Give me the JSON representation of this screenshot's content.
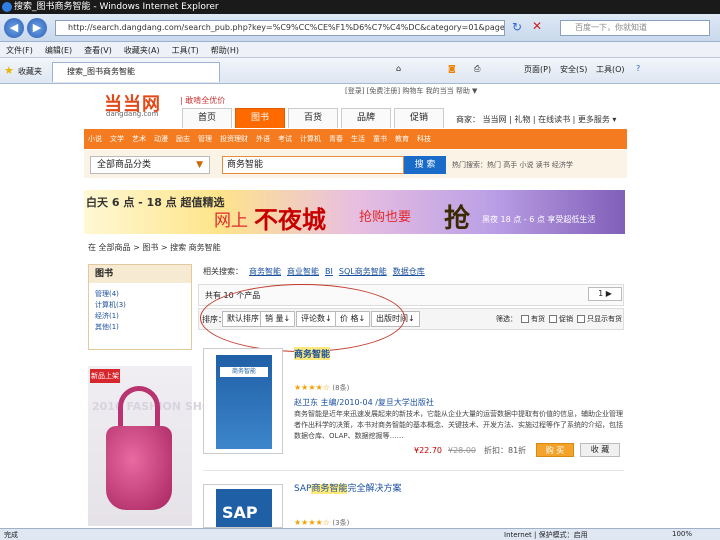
{
  "window": {
    "title": "搜索_图书商务智能 - Windows Internet Explorer"
  },
  "toolbar": {
    "back": "◀",
    "forward": "▶",
    "url": "http://search.dangdang.com/search_pub.php?key=%C9%CC%CE%F1%D6%C7%C4%DC&category=01&page=1&in-stock=1",
    "search_placeholder": "百度一下，你就知道"
  },
  "menu": [
    "文件(F)",
    "编辑(E)",
    "查看(V)",
    "收藏夹(A)",
    "工具(T)",
    "帮助(H)"
  ],
  "favbar": {
    "favorites": "收藏夹",
    "tab": "搜索_图书商务智能",
    "page": "页面(P)",
    "safety": "安全(S)",
    "tools": "工具(O)"
  },
  "site": {
    "logo": "当当网",
    "logo_sub": "dangdang.com",
    "slogan": "| 敢啃全优价",
    "top_links": "[登录] [免费注册] 购物车 我的当当 帮助 ▼",
    "tabs": [
      "首页",
      "图书",
      "百货",
      "品牌",
      "促销"
    ],
    "right_links": "商家： 当当网 | 礼物 | 在线读书 | 更多服务 ▾",
    "orange_nav": [
      "小说",
      "文学",
      "艺术",
      "动漫",
      "励志",
      "管理",
      "投资理财",
      "外语",
      "考试",
      "计算机",
      "青春",
      "生活",
      "童书",
      "教育",
      "科技"
    ],
    "category_select": "全部商品分类",
    "search_query": "商务智能",
    "search_button": "搜 索",
    "hot_words": "热门搜索：热门 高手 小说 读书 经济学"
  },
  "banner": {
    "line1": "白天 6 点 - 18 点 超值精选",
    "line2": "网上",
    "line3": "不夜城",
    "line4": "抢购也要",
    "line5": "抢",
    "line6": "黑夜 18 点 - 6 点 享受超低生活"
  },
  "breadcrumb": "在 全部商品 > 图书 > 搜索 商务智能",
  "left_panel": {
    "header": "图书",
    "items": [
      "管理(4)",
      "计算机(3)",
      "经济(1)",
      "其他(1)"
    ]
  },
  "ad": {
    "tag": "新品上架",
    "watermark": "2010 FASHION SHOW"
  },
  "subnav": [
    "相关搜索：",
    "商务智能",
    "商业智能",
    "BI",
    "SQL商务智能",
    "数据仓库"
  ],
  "results": {
    "count_text": "共有 10 个产品",
    "pager": "1 ▶",
    "sort_label": "排序：",
    "sort_options": [
      "默认排序",
      "销 量↓",
      "评论数↓",
      "价 格↓",
      "出版时间↓"
    ],
    "filter_label": "筛选：",
    "filters": [
      "有货",
      "促销",
      "只显示有货"
    ]
  },
  "product1": {
    "cover_text": "商务智能",
    "title": "商务智能",
    "stars": "★★★★☆",
    "reviews": "(8条)",
    "author": "赵卫东 主编/2010-04 /复旦大学出版社",
    "desc": "商务智能是近年来迅速发展起来的新技术，它能从企业大量的运营数据中提取有价值的信息，辅助企业管理者作出科学的决策，本书对商务智能的基本概念、关键技术、开发方法、实施过程等作了系统的介绍，包括数据仓库、OLAP、数据挖掘等……",
    "price": "¥22.70",
    "old_price": "¥28.00",
    "comments": "折扣：81折",
    "buy": "购 买",
    "fav": "收 藏"
  },
  "product2": {
    "cover_text": "SAP",
    "title_prefix": "SAP",
    "title_highlight": "商务智能",
    "title_suffix": "完全解决方案",
    "stars": "★★★★☆",
    "reviews": "(3条)"
  },
  "status": {
    "left": "完成",
    "zone": "Internet | 保护模式：启用",
    "zoom": "100%"
  },
  "colors": {
    "accent": "#f47b20",
    "link": "#1a4fa0",
    "annotation": "#c23a2a"
  }
}
